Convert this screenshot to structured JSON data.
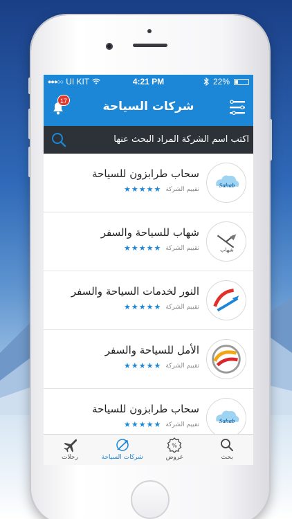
{
  "status_bar": {
    "carrier": "UI KIT",
    "time": "4:21 PM",
    "battery": "22%"
  },
  "header": {
    "title": "شركات السياحة",
    "notification_count": "17"
  },
  "search": {
    "placeholder": "اكتب اسم الشركة المراد البحث عنها"
  },
  "companies": [
    {
      "name": "سحاب طرابزون للسياحة",
      "rating_label": "تقييم الشركة",
      "stars": "★★★★★",
      "logo_text": "Sahab",
      "rating": 5
    },
    {
      "name": "شهاب للسياحة والسفر",
      "rating_label": "تقييم الشركة",
      "stars": "★★★★★",
      "logo_text": "شهاب",
      "rating": 5
    },
    {
      "name": "النور لخدمات السياحة والسفر",
      "rating_label": "تقييم الشركة",
      "stars": "★★★★★",
      "logo_text": "",
      "rating": 5
    },
    {
      "name": "الأمل للسياحة والسفر",
      "rating_label": "تقييم الشركة",
      "stars": "★★★★★",
      "logo_text": "",
      "rating": 5
    },
    {
      "name": "سحاب طرابزون للسياحة",
      "rating_label": "تقييم الشركة",
      "stars": "★★★★★",
      "logo_text": "Sahab",
      "rating": 5
    }
  ],
  "tabs": [
    {
      "label": "بحث",
      "icon": "search-icon"
    },
    {
      "label": "عروض",
      "icon": "offers-icon"
    },
    {
      "label": "شركات السياحة",
      "icon": "travel-agencies-icon",
      "active": true
    },
    {
      "label": "رحلات",
      "icon": "plane-icon"
    }
  ],
  "colors": {
    "primary": "#1b87d6",
    "search_bg": "#2c3238",
    "badge": "#e03a2f"
  }
}
